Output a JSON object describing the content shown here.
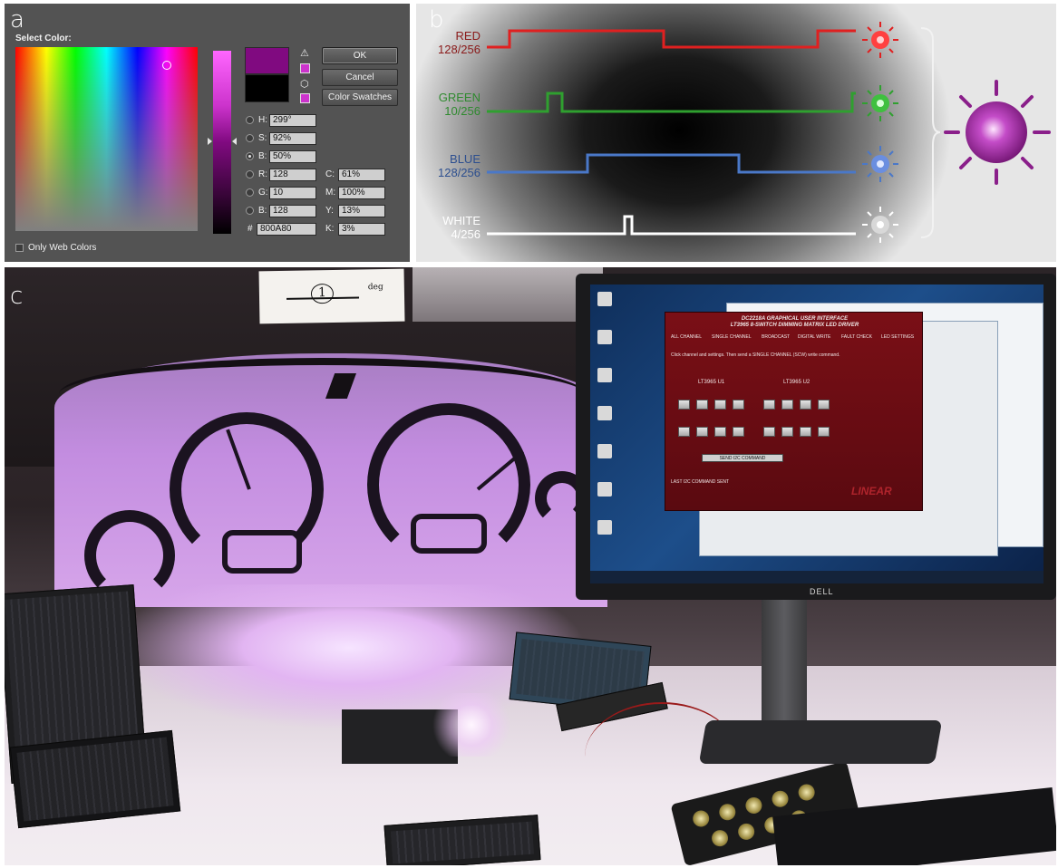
{
  "panel_a": {
    "letter": "a",
    "title": "Select Color:",
    "buttons": {
      "ok": "OK",
      "cancel": "Cancel",
      "swatches": "Color Swatches"
    },
    "fields": {
      "h_label": "H:",
      "h_value": "299°",
      "s_label": "S:",
      "s_value": "92%",
      "b_label": "B:",
      "b_value": "50%",
      "r_label": "R:",
      "r_value": "128",
      "g_label": "G:",
      "g_value": "10",
      "bl_label": "B:",
      "bl_value": "128",
      "c_label": "C:",
      "c_value": "61%",
      "m_label": "M:",
      "m_value": "100%",
      "y_label": "Y:",
      "y_value": "13%",
      "k_label": "K:",
      "k_value": "3%",
      "hex_label": "#",
      "hex_value": "800A80"
    },
    "only_web_colors": "Only Web Colors",
    "selected_color": "#800a80"
  },
  "panel_b": {
    "letter": "b",
    "channels": [
      {
        "name": "RED",
        "value": "128/256",
        "color": "#e02020"
      },
      {
        "name": "GREEN",
        "value": "10/256",
        "color": "#2fa02f"
      },
      {
        "name": "BLUE",
        "value": "128/256",
        "color": "#4a78c8"
      },
      {
        "name": "WHITE",
        "value": "4/256",
        "color": "#ffffff"
      }
    ],
    "mixed_color": "#9b2fa0"
  },
  "panel_c": {
    "letter": "c",
    "paper_number": "1",
    "paper_note": "deg",
    "monitor_brand": "DELL",
    "gui": {
      "title_line1": "DC2218A GRAPHICAL USER INTERFACE",
      "title_line2": "LT3965 8-SWITCH DIMMING MATRIX LED DRIVER",
      "tabs": [
        "ALL CHANNEL",
        "SINGLE CHANNEL",
        "BROADCAST",
        "DIGITAL WRITE",
        "FAULT CHECK",
        "LED SETTINGS"
      ],
      "instruction": "Click channel and settings. Then send a SINGLE CHANNEL (SCW) write command.",
      "u1_label": "LT3965 U1",
      "u2_label": "LT3965 U2",
      "send_button": "SEND I2C COMMAND",
      "last_cmd": "LAST I2C COMMAND SENT",
      "logo": "LINEAR"
    }
  }
}
